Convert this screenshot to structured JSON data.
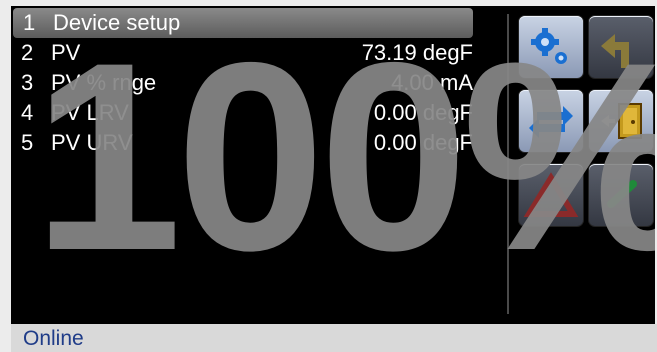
{
  "menu": {
    "items": [
      {
        "num": "1",
        "label": "Device setup",
        "value": ""
      },
      {
        "num": "2",
        "label": "PV",
        "value": "73.19 degF"
      },
      {
        "num": "3",
        "label": "PV % rnge",
        "value": "4.00 mA"
      },
      {
        "num": "4",
        "label": "PV LRV",
        "value": "0.00 degF"
      },
      {
        "num": "5",
        "label": "PV URV",
        "value": "0.00 degF"
      }
    ]
  },
  "toolbar": {
    "buttons": [
      {
        "icon": "gears-icon"
      },
      {
        "icon": "back-arrow-icon"
      },
      {
        "icon": "swap-arrows-icon"
      },
      {
        "icon": "exit-door-icon"
      },
      {
        "icon": "warning-icon"
      },
      {
        "icon": "status-toggle-icon"
      }
    ]
  },
  "overlay": {
    "text": "100%",
    "progress_percent": 100
  },
  "status": {
    "text": "Online",
    "color": "#1f3c88"
  }
}
